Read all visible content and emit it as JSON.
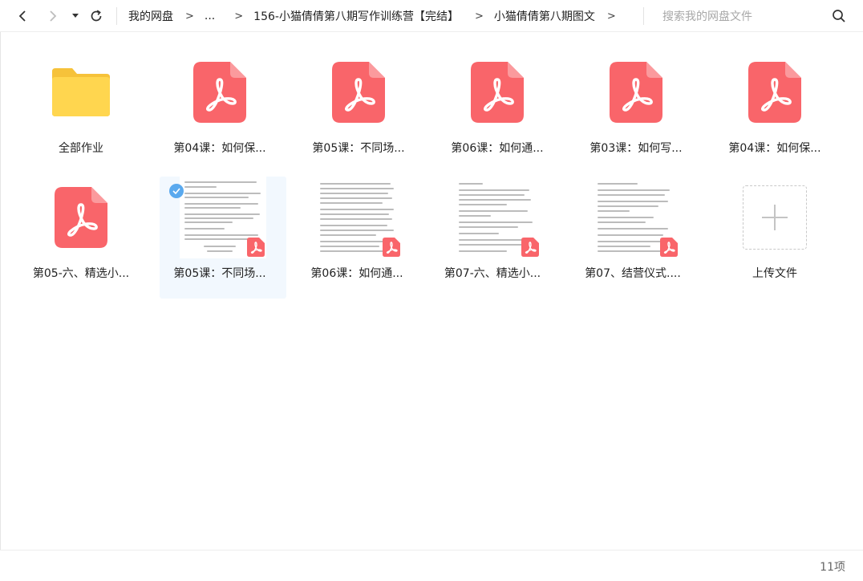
{
  "nav": {
    "back_icon": "chevron-left-icon",
    "forward_icon": "chevron-right-icon",
    "history_icon": "caret-down-icon",
    "refresh_icon": "refresh-icon"
  },
  "breadcrumb": {
    "items": [
      "我的网盘",
      "...",
      "156-小猫倩倩第八期写作训练营【完结】",
      "小猫倩倩第八期图文"
    ],
    "separator": ">"
  },
  "search": {
    "placeholder": "搜索我的网盘文件",
    "icon": "search-icon"
  },
  "files": [
    {
      "name": "全部作业",
      "type": "folder"
    },
    {
      "name": "第04课：如何保...",
      "type": "pdf"
    },
    {
      "name": "第05课：不同场...",
      "type": "pdf"
    },
    {
      "name": "第06课：如何通...",
      "type": "pdf"
    },
    {
      "name": "第03课：如何写...",
      "type": "pdf"
    },
    {
      "name": "第04课：如何保...",
      "type": "pdf"
    },
    {
      "name": "第05-六、精选小...",
      "type": "pdf"
    },
    {
      "name": "第05课：不同场...",
      "type": "pdf-preview",
      "selected": true
    },
    {
      "name": "第06课：如何通...",
      "type": "pdf-preview"
    },
    {
      "name": "第07-六、精选小...",
      "type": "pdf-preview"
    },
    {
      "name": "第07、结营仪式....",
      "type": "pdf-preview"
    },
    {
      "name": "上传文件",
      "type": "upload"
    }
  ],
  "status": {
    "count": "11项"
  },
  "colors": {
    "pdf_red": "#f9656a",
    "folder_yellow": "#ffd64f",
    "selected_bg": "#f2f8fe",
    "check_blue": "#5aa9ee"
  }
}
